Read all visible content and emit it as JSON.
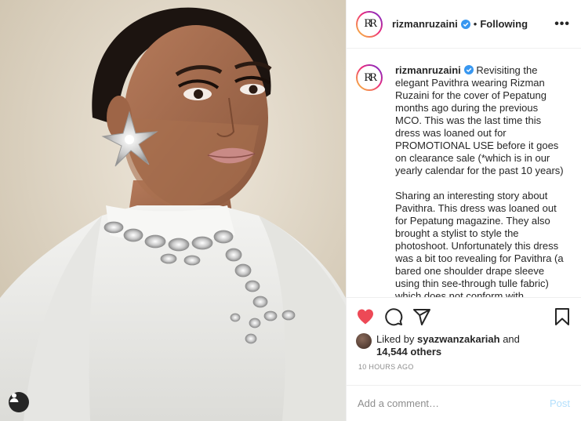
{
  "colors": {
    "accent_blue": "#0095f6",
    "like_red": "#ed4956",
    "post_disabled": "#b2dffc",
    "text_primary": "#262626",
    "text_secondary": "#8e8e8e"
  },
  "header": {
    "username": "rizmanruzaini",
    "separator": "•",
    "follow_status": "Following",
    "more_label": "•••"
  },
  "caption": {
    "username": "rizmanruzaini",
    "paragraph1": "Revisiting the elegant Pavithra wearing Rizman Ruzaini for the cover of Pepatung months ago during the previous MCO. This was the last time this dress was loaned out for PROMOTIONAL USE before it goes on clearance sale (*which is in our yearly calendar for the past 10 years)",
    "paragraph2": "Sharing an interesting story about Pavithra. This dress was loaned out for Pepatung magazine. They also brought a stylist to style the photoshoot. Unfortunately this dress was a bit too revealing for Pavithra (a bared one shoulder drape sleeve using thin see-through tulle fabric) which does not conform with"
  },
  "likes": {
    "prefix": "Liked by",
    "user": "syazwanzakariah",
    "and": "and",
    "others": "14,544 others"
  },
  "timestamp": "10 HOURS AGO",
  "comment": {
    "placeholder": "Add a comment…",
    "post_label": "Post"
  },
  "icons": {
    "like": "heart-filled-icon",
    "comment": "comment-bubble-icon",
    "share": "paper-plane-icon",
    "save": "bookmark-icon",
    "verified": "verified-badge-icon",
    "user_tag": "user-tag-icon"
  }
}
